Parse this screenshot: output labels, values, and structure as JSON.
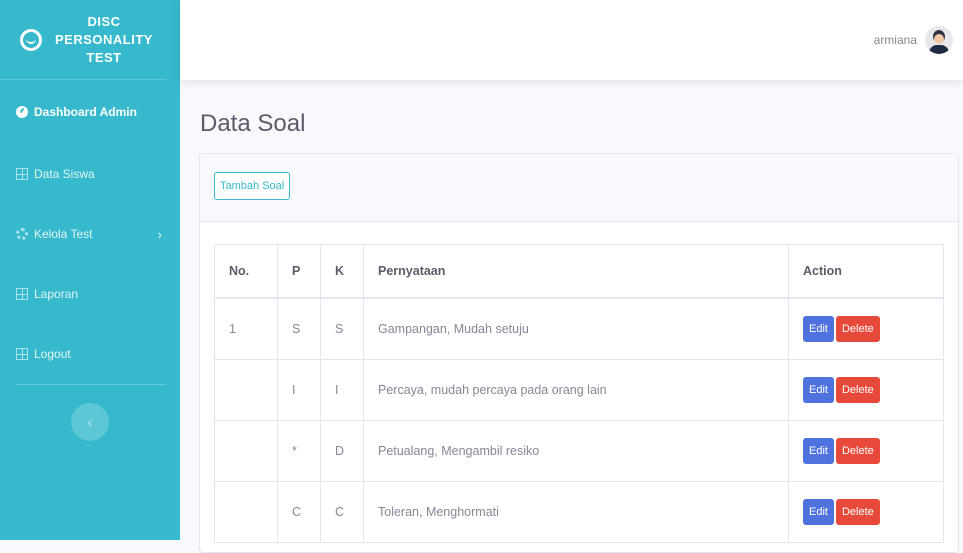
{
  "brand": {
    "line1": "DISC",
    "line2": "PERSONALITY",
    "line3": "TEST"
  },
  "sidebar": {
    "items": [
      {
        "label": "Dashboard Admin"
      },
      {
        "label": "Data Siswa"
      },
      {
        "label": "Kelola Test"
      },
      {
        "label": "Laporan"
      },
      {
        "label": "Logout"
      }
    ],
    "toggle_symbol": "‹"
  },
  "topbar": {
    "user_name": "armiana"
  },
  "page": {
    "title": "Data Soal"
  },
  "actions": {
    "add_label": "Tambah Soal"
  },
  "table": {
    "headers": [
      "No.",
      "P",
      "K",
      "Pernyataan",
      "Action"
    ],
    "rows": [
      {
        "no": "1",
        "p": "S",
        "k": "S",
        "text": "Gampangan, Mudah setuju"
      },
      {
        "no": "",
        "p": "I",
        "k": "I",
        "text": "Percaya, mudah percaya pada orang lain"
      },
      {
        "no": "",
        "p": "*",
        "k": "D",
        "text": "Petualang, Mengambil resiko"
      },
      {
        "no": "",
        "p": "C",
        "k": "C",
        "text": "Toleran, Menghormati"
      }
    ],
    "edit_label": "Edit",
    "delete_label": "Delete"
  },
  "colors": {
    "sidebar": "#36b9cc",
    "edit": "#4e73df",
    "delete": "#e74a3b"
  }
}
